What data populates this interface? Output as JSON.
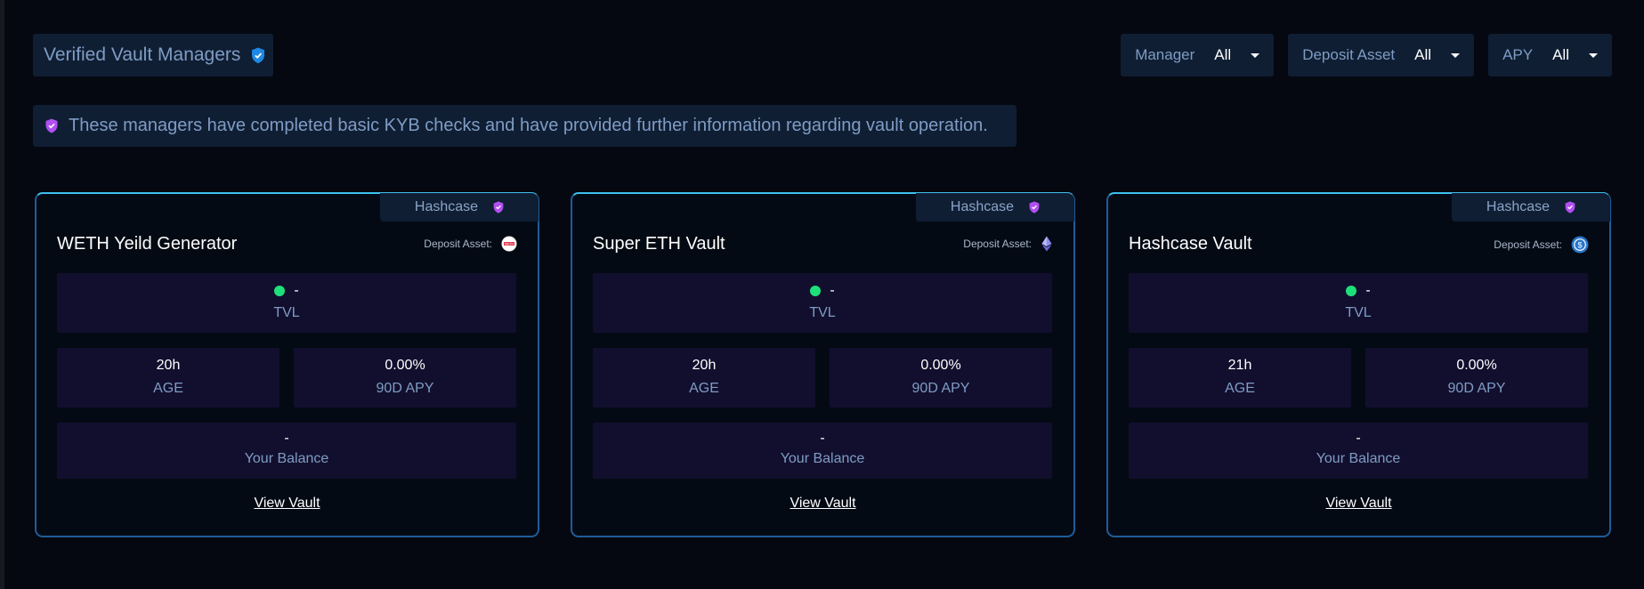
{
  "header": {
    "title": "Verified Vault Managers",
    "filters": [
      {
        "label": "Manager",
        "value": "All"
      },
      {
        "label": "Deposit Asset",
        "value": "All"
      },
      {
        "label": "APY",
        "value": "All"
      }
    ]
  },
  "notice": {
    "text": "These managers have completed basic KYB checks and have provided further information regarding vault operation."
  },
  "vaults": [
    {
      "manager": "Hashcase",
      "name": "WETH Yeild Generator",
      "deposit_label": "Deposit Asset:",
      "asset_icon": "weth-icon",
      "tvl": "-",
      "tvl_label": "TVL",
      "age": "20h",
      "age_label": "AGE",
      "apy": "0.00%",
      "apy_label": "90D APY",
      "balance": "-",
      "balance_label": "Your Balance",
      "view_label": "View Vault"
    },
    {
      "manager": "Hashcase",
      "name": "Super ETH Vault",
      "deposit_label": "Deposit Asset:",
      "asset_icon": "eth-icon",
      "tvl": "-",
      "tvl_label": "TVL",
      "age": "20h",
      "age_label": "AGE",
      "apy": "0.00%",
      "apy_label": "90D APY",
      "balance": "-",
      "balance_label": "Your Balance",
      "view_label": "View Vault"
    },
    {
      "manager": "Hashcase",
      "name": "Hashcase Vault",
      "deposit_label": "Deposit Asset:",
      "asset_icon": "usdc-icon",
      "tvl": "-",
      "tvl_label": "TVL",
      "age": "21h",
      "age_label": "AGE",
      "apy": "0.00%",
      "apy_label": "90D APY",
      "balance": "-",
      "balance_label": "Your Balance",
      "view_label": "View Vault"
    }
  ],
  "colors": {
    "background": "#050810",
    "panel": "#0f1e33",
    "stat_box": "#120f2e",
    "card_border": "#3fc0ef",
    "status_dot": "#1ee07a",
    "verified_badge": "#b050f0"
  }
}
